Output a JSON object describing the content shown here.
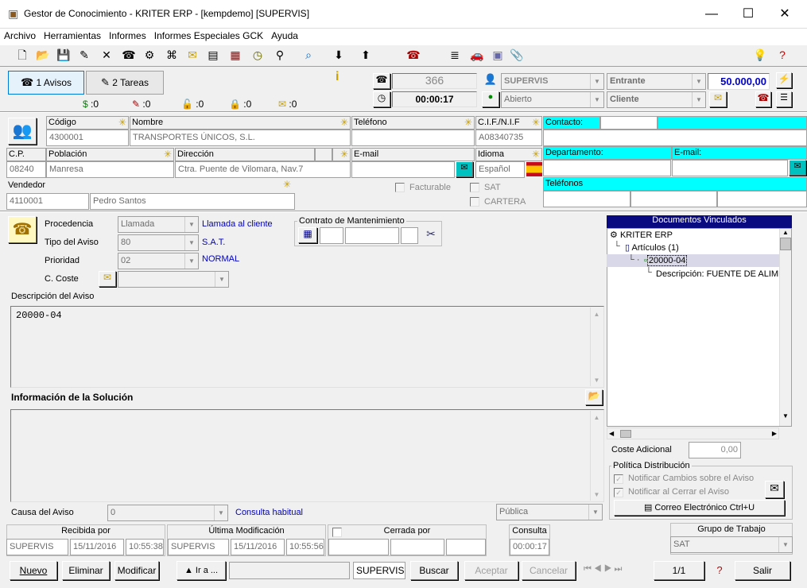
{
  "window": {
    "title": "Gestor de Conocimiento - KRITER ERP - [kempdemo] [SUPERVIS]"
  },
  "menu": [
    "Archivo",
    "Herramientas",
    "Informes",
    "Informes Especiales GCK",
    "Ayuda"
  ],
  "tabs": {
    "avisos": "1 Avisos",
    "tareas": "2 Tareas"
  },
  "counters": [
    ":0",
    ":0",
    ":0",
    ":0",
    ":0"
  ],
  "header": {
    "number": "366",
    "timer": "00:00:17",
    "user": "SUPERVIS",
    "state": "Abierto",
    "direction": "Entrante",
    "client_type": "Cliente",
    "amount": "50.000,00"
  },
  "client": {
    "codigo_label": "Código",
    "codigo": "4300001",
    "nombre_label": "Nombre",
    "nombre": "TRANSPORTES ÚNICOS, S.L.",
    "telefono_label": "Teléfono",
    "telefono": "",
    "cif_label": "C.I.F./N.I.F",
    "cif": "A08340735",
    "cp_label": "C.P.",
    "cp": "08240",
    "poblacion_label": "Población",
    "poblacion": "Manresa",
    "direccion_label": "Dirección",
    "direccion": "Ctra. Puente de Vilomara, Nav.7",
    "email_label": "E-mail",
    "email": "",
    "idioma_label": "Idioma",
    "idioma": "Español",
    "vendedor_label": "Vendedor",
    "vendedor_code": "4110001",
    "vendedor_name": "Pedro Santos",
    "facturable": "Facturable",
    "sat": "SAT",
    "cartera": "CARTERA"
  },
  "contact": {
    "contacto": "Contacto:",
    "departamento": "Departamento:",
    "email": "E-mail:",
    "telefonos": "Teléfonos"
  },
  "aviso": {
    "procedencia_label": "Procedencia",
    "procedencia": "Llamada",
    "procedencia_desc": "Llamada al cliente",
    "tipo_label": "Tipo del Aviso",
    "tipo": "80",
    "tipo_desc": "S.A.T.",
    "prioridad_label": "Prioridad",
    "prioridad": "02",
    "prioridad_desc": "NORMAL",
    "coste_label": "C. Coste",
    "coste": "",
    "contrato_label": "Contrato de Mantenimiento",
    "descripcion_label": "Descripción del Aviso",
    "descripcion": "20000-04",
    "solucion_label": "Información de la Solución",
    "causa_label": "Causa del Aviso",
    "causa": "0",
    "causa_desc": "Consulta habitual",
    "visibilidad": "Pública"
  },
  "docs": {
    "title": "Documentos Vinculados",
    "tree": [
      "KRITER ERP",
      "Artículos (1)",
      "20000-04",
      "Descripción: FUENTE DE ALIME"
    ]
  },
  "coste_adicional": {
    "label": "Coste Adicional",
    "value": "0,00"
  },
  "politica": {
    "title": "Política Distribución",
    "notificar_cambios": "Notificar Cambios sobre el Aviso",
    "notificar_cerrar": "Notificar al Cerrar el Aviso",
    "correo_btn": "Correo Electrónico Ctrl+U"
  },
  "audit": {
    "recibida_label": "Recibida por",
    "recibida_user": "SUPERVIS",
    "recibida_date": "15/11/2016",
    "recibida_time": "10:55:38",
    "modif_label": "Última Modificación",
    "modif_user": "SUPERVIS",
    "modif_date": "15/11/2016",
    "modif_time": "10:55:56",
    "cerrada_label": "Cerrada por",
    "consulta_label": "Consulta",
    "consulta_time": "00:00:17",
    "grupo_label": "Grupo de Trabajo",
    "grupo": "SAT"
  },
  "footer": {
    "nuevo": "Nuevo",
    "eliminar": "Eliminar",
    "modificar": "Modificar",
    "ira": "▲ Ir a ...",
    "search_user": "SUPERVIS",
    "buscar": "Buscar",
    "aceptar": "Aceptar",
    "cancelar": "Cancelar",
    "pager": "1/1",
    "salir": "Salir"
  }
}
